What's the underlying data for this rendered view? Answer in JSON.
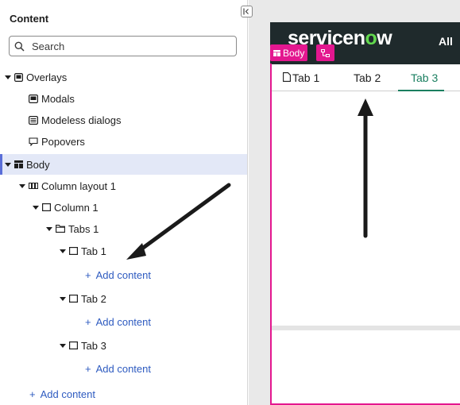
{
  "panel": {
    "title": "Content",
    "search_placeholder": "Search"
  },
  "tree": {
    "overlays": "Overlays",
    "modals": "Modals",
    "modeless": "Modeless dialogs",
    "popovers": "Popovers",
    "body": "Body",
    "column_layout": "Column layout 1",
    "column": "Column 1",
    "tabs": "Tabs 1",
    "tab1": "Tab 1",
    "tab2": "Tab 2",
    "tab3": "Tab 3",
    "add_content": "Add content"
  },
  "canvas": {
    "logo_main": "servicen",
    "logo_o": "o",
    "logo_end": "w",
    "all_menu": "All",
    "body_tag": "Body",
    "tabs": [
      "Tab 1",
      "Tab 2",
      "Tab 3"
    ],
    "active_tab": "Tab 3"
  },
  "colors": {
    "accent_pink": "#e3178f",
    "tab_active": "#1a7f60",
    "link": "#2e5bc0",
    "selected_bg": "#e3e8f7",
    "header_bg": "#1f2a2c"
  }
}
